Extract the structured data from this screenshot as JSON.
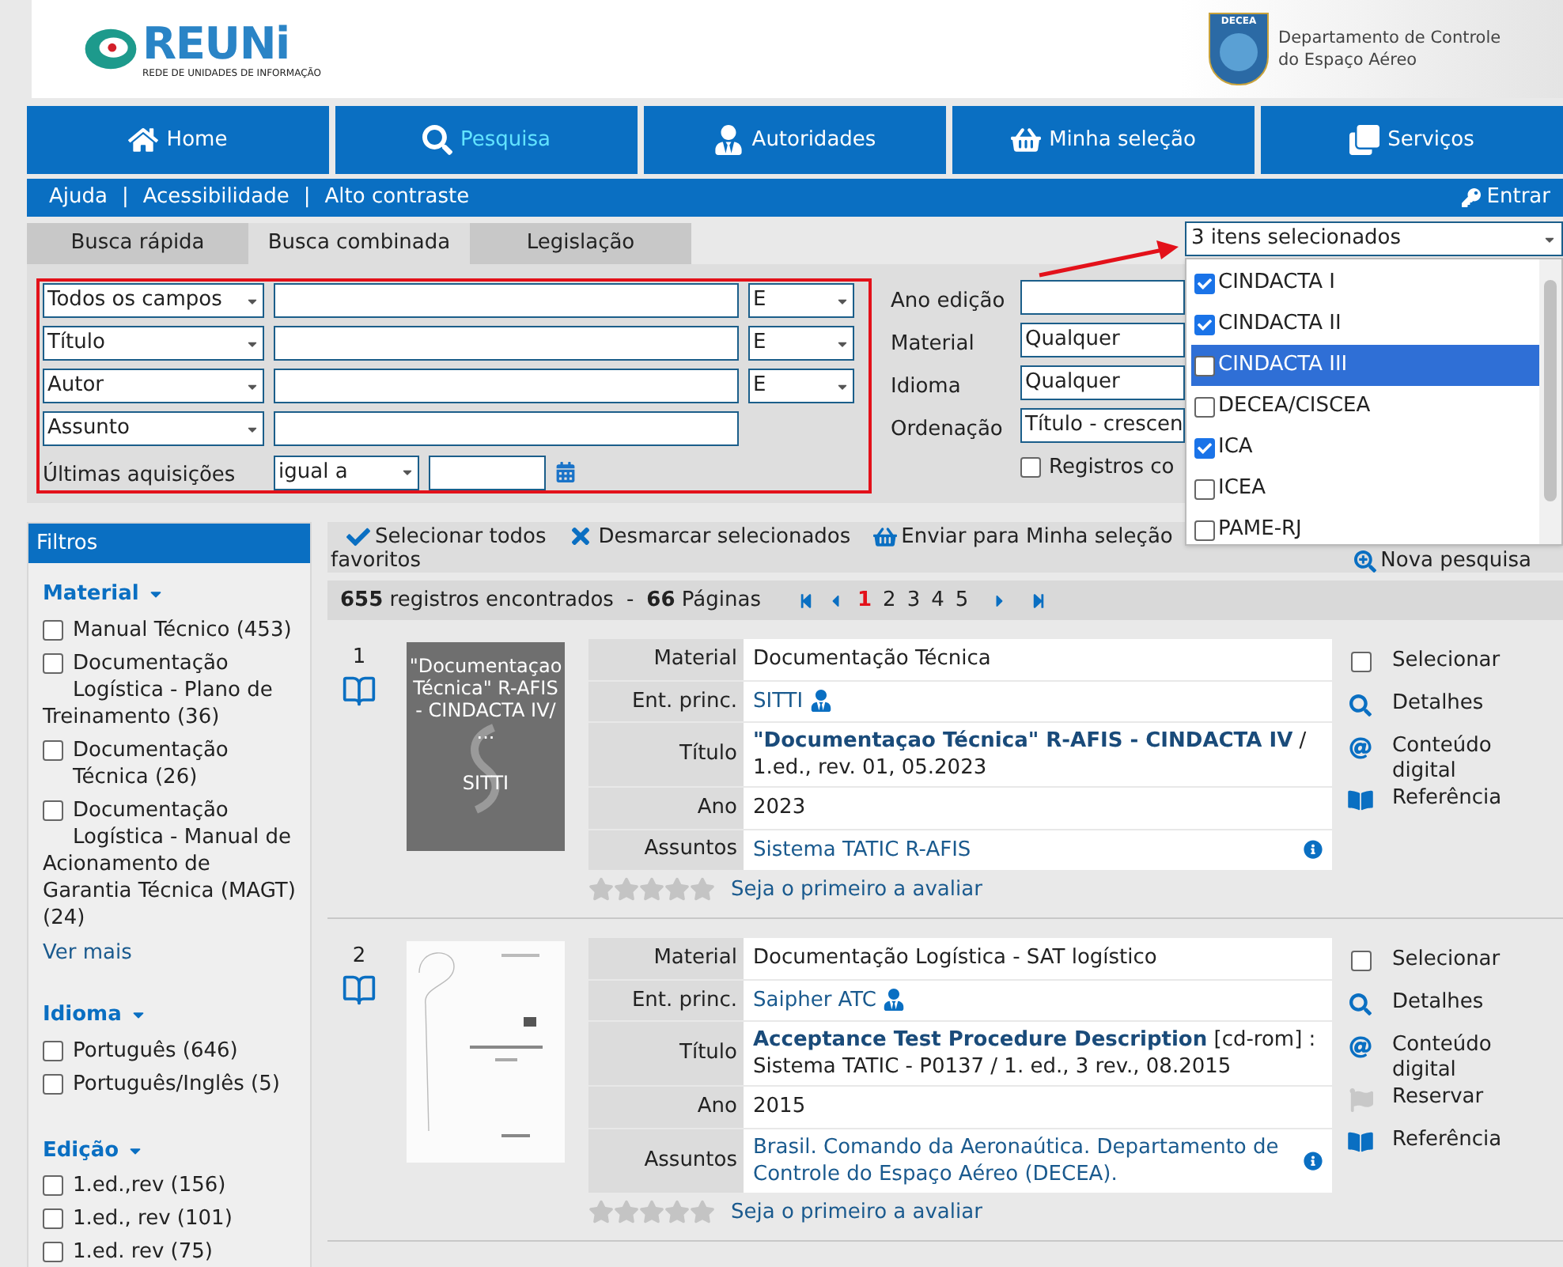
{
  "header": {
    "logo_text": "REUNi",
    "logo_subtitle": "REDE DE UNIDADES DE INFORMAÇÃO",
    "org_badge": "DECEA",
    "org_name": "Departamento de Controle do Espaço Aéreo"
  },
  "nav": [
    {
      "label": "Home",
      "selected": false
    },
    {
      "label": "Pesquisa",
      "selected": true
    },
    {
      "label": "Autoridades",
      "selected": false
    },
    {
      "label": "Minha seleção",
      "selected": false
    },
    {
      "label": "Serviços",
      "selected": false
    }
  ],
  "links": {
    "items": [
      "Ajuda",
      "Acessibilidade",
      "Alto contraste"
    ],
    "separator": "|",
    "login": "Entrar"
  },
  "tabs": [
    {
      "label": "Busca rápida",
      "selected": false
    },
    {
      "label": "Busca combinada",
      "selected": true
    },
    {
      "label": "Legislação",
      "selected": false
    }
  ],
  "search_rows": [
    {
      "field": "Todos os campos",
      "operator": "E"
    },
    {
      "field": "Título",
      "operator": "E"
    },
    {
      "field": "Autor",
      "operator": "E"
    },
    {
      "field": "Assunto"
    }
  ],
  "last_acquisitions": {
    "label": "Últimas aquisições",
    "comparator": "igual a"
  },
  "side_fields": [
    {
      "label": "Ano edição"
    },
    {
      "label": "Material",
      "value": "Qualquer"
    },
    {
      "label": "Idioma",
      "value": "Qualquer"
    },
    {
      "label": "Ordenação",
      "value": "Título - crescen"
    }
  ],
  "records_option": {
    "label": "Registros co",
    "checked": false
  },
  "multiselect": {
    "value": "3 itens selecionados",
    "options": [
      {
        "label": "CINDACTA I",
        "checked": true,
        "highlighted": false
      },
      {
        "label": "CINDACTA II",
        "checked": true,
        "highlighted": false
      },
      {
        "label": "CINDACTA III",
        "checked": false,
        "highlighted": true
      },
      {
        "label": "DECEA/CISCEA",
        "checked": false,
        "highlighted": false
      },
      {
        "label": "ICA",
        "checked": true,
        "highlighted": false
      },
      {
        "label": "ICEA",
        "checked": false,
        "highlighted": false
      },
      {
        "label": "PAME-RJ",
        "checked": false,
        "highlighted": false
      }
    ]
  },
  "toolbar": {
    "actions": [
      "Selecionar todos",
      "Desmarcar selecionados",
      "Enviar para Minha seleção"
    ],
    "wrapped": "favoritos",
    "new_search": "Nova pesquisa"
  },
  "summary": {
    "count": "655",
    "count_label": "registros encontrados",
    "separator": "-",
    "pages": "66",
    "pages_label": "Páginas",
    "page_links": [
      {
        "label": "1",
        "selected": true
      },
      {
        "label": "2",
        "selected": false
      },
      {
        "label": "3",
        "selected": false
      },
      {
        "label": "4",
        "selected": false
      },
      {
        "label": "5",
        "selected": false
      }
    ]
  },
  "filters": {
    "title": "Filtros",
    "groups": [
      {
        "title": "Material",
        "items": [
          {
            "label": "Manual Técnico (453)",
            "checked": false
          },
          {
            "label": "Documentação Logística - Plano de Treinamento (36)",
            "checked": false
          },
          {
            "label": "Documentação Técnica (26)",
            "checked": false
          },
          {
            "label": "Documentação Logística - Manual de Acionamento de Garantia Técnica (MAGT) (24)",
            "checked": false
          }
        ],
        "more": "Ver mais"
      },
      {
        "title": "Idioma",
        "items": [
          {
            "label": "Português (646)",
            "checked": false
          },
          {
            "label": "Português/Inglês (5)",
            "checked": false
          }
        ]
      },
      {
        "title": "Edição",
        "items": [
          {
            "label": "1.ed.,rev (156)",
            "checked": false
          },
          {
            "label": "1.ed., rev (101)",
            "checked": false
          },
          {
            "label": "1.ed. rev (75)",
            "checked": false
          }
        ]
      }
    ]
  },
  "results": [
    {
      "number": "1",
      "cover": {
        "kind": "generated",
        "title": "\"Documentaçao Técnica\" R-AFIS - CINDACTA IV/ ...",
        "author": "SITTI"
      },
      "fields": [
        {
          "label": "Material",
          "kind": "text",
          "value": "Documentação Técnica"
        },
        {
          "label": "Ent. princ.",
          "kind": "person",
          "value": "SITTI"
        },
        {
          "label": "Título",
          "kind": "title",
          "value": "**\"Documentaçao Técnica\" R-AFIS - CINDACTA IV** / 1.ed., rev. 01, 05.2023"
        },
        {
          "label": "Ano",
          "kind": "text",
          "value": "2023"
        },
        {
          "label": "Assuntos",
          "kind": "subject",
          "value": "Sistema TATIC R-AFIS"
        }
      ],
      "actions": [
        {
          "kind": "select",
          "label": "Selecionar",
          "checked": false
        },
        {
          "kind": "details",
          "label": "Detalhes"
        },
        {
          "kind": "digital",
          "label": "Conteúdo digital"
        },
        {
          "kind": "reference",
          "label": "Referência"
        }
      ],
      "rating": {
        "stars": 0,
        "label": "Seja o primeiro a avaliar"
      }
    },
    {
      "number": "2",
      "fields": [
        {
          "label": "Material",
          "kind": "text",
          "value": "Documentação Logística - SAT logístico"
        },
        {
          "label": "Ent. princ.",
          "kind": "person",
          "value": "Saipher ATC"
        },
        {
          "label": "Título",
          "kind": "title",
          "value": "**Acceptance Test Procedure Description** [cd-rom] : Sistema TATIC - P0137 / 1. ed., 3 rev., 08.2015"
        },
        {
          "label": "Ano",
          "kind": "text",
          "value": "2015"
        },
        {
          "label": "Assuntos",
          "kind": "subject",
          "value": "Brasil. Comando da Aeronaútica. Departamento de Controle do Espaço Aéreo (DECEA)."
        }
      ],
      "actions": [
        {
          "kind": "select",
          "label": "Selecionar",
          "checked": false
        },
        {
          "kind": "details",
          "label": "Detalhes"
        },
        {
          "kind": "digital",
          "label": "Conteúdo digital"
        },
        {
          "kind": "reserve",
          "label": "Reservar"
        },
        {
          "kind": "reference",
          "label": "Referência"
        }
      ],
      "rating": {
        "stars": 0,
        "label": "Seja o primeiro a avaliar"
      }
    }
  ]
}
